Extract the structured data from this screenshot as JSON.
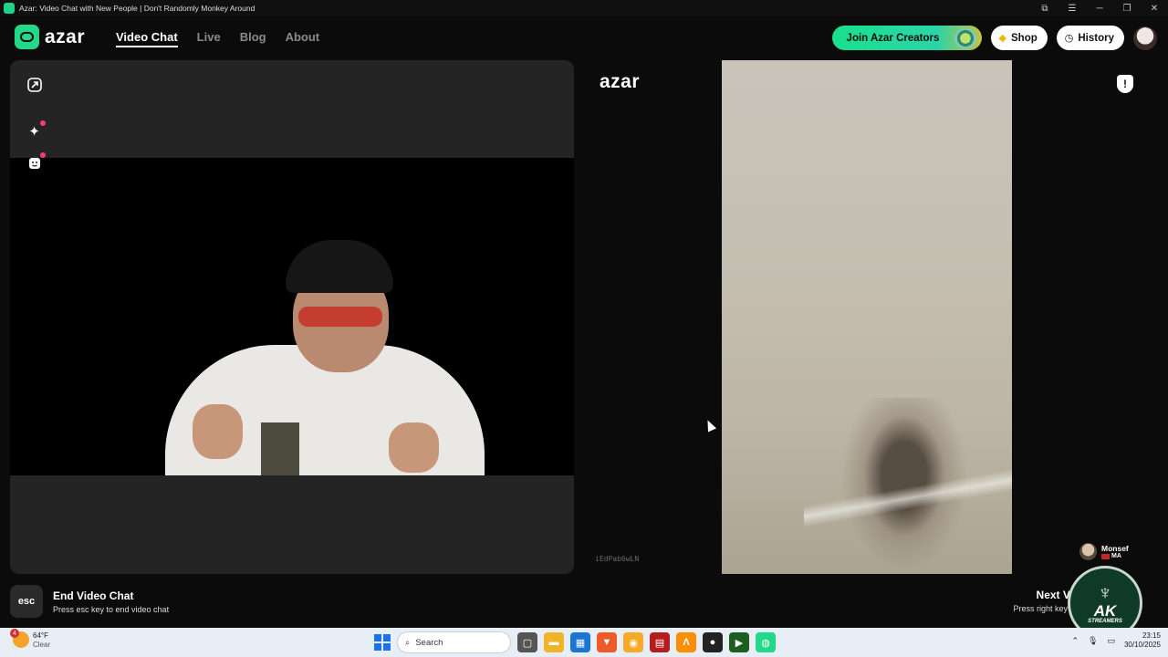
{
  "window": {
    "title": "Azar: Video Chat with New People | Don't Randomly Monkey Around",
    "controls": [
      "⧉",
      "☰",
      "─",
      "❐",
      "✕"
    ]
  },
  "brand": {
    "name": "azar"
  },
  "nav": {
    "items": [
      {
        "label": "Video Chat",
        "active": true
      },
      {
        "label": "Live",
        "active": false
      },
      {
        "label": "Blog",
        "active": false
      },
      {
        "label": "About",
        "active": false
      }
    ]
  },
  "header_actions": {
    "creators_label": "Join Azar Creators",
    "shop_label": "Shop",
    "history_label": "History"
  },
  "left_panel": {
    "tools": [
      "expand-icon",
      "effects-sparkle-icon",
      "sticker-icon"
    ]
  },
  "right_panel": {
    "logo": "azar",
    "match_id": "iEdPab6wLN",
    "user": {
      "name": "Monsef",
      "country": "MA"
    }
  },
  "hints": {
    "end": {
      "key": "esc",
      "title": "End Video Chat",
      "subtitle": "Press esc key to end video chat"
    },
    "next": {
      "title": "Next Vide",
      "subtitle": "Press right key to m"
    }
  },
  "watermark": {
    "ak": "AK",
    "sub": "STREAMERS"
  },
  "taskbar": {
    "weather": {
      "temp": "64°F",
      "condition": "Clear",
      "badge": "4"
    },
    "search_placeholder": "Search",
    "clock": {
      "time": "23:15",
      "date": "30/10/2025"
    },
    "apps": [
      {
        "name": "task-view",
        "color": "#555555",
        "glyph": "▢"
      },
      {
        "name": "file-explorer",
        "color": "#f0b429",
        "glyph": "▬"
      },
      {
        "name": "store",
        "color": "#1976d2",
        "glyph": "▦"
      },
      {
        "name": "brave",
        "color": "#f05a28",
        "glyph": "▼"
      },
      {
        "name": "notifications",
        "color": "#f7a928",
        "glyph": "◉"
      },
      {
        "name": "media",
        "color": "#b71c1c",
        "glyph": "▤"
      },
      {
        "name": "transfer",
        "color": "#ff8f00",
        "glyph": "Λ"
      },
      {
        "name": "obs",
        "color": "#222222",
        "glyph": "●"
      },
      {
        "name": "terminal",
        "color": "#1b5e20",
        "glyph": "▶"
      },
      {
        "name": "azar",
        "color": "#22d98a",
        "glyph": "◍"
      }
    ]
  },
  "colors": {
    "accent": "#22d98a",
    "background": "#0b0b0b",
    "panel": "#242424",
    "notify": "#ff3d6c"
  }
}
